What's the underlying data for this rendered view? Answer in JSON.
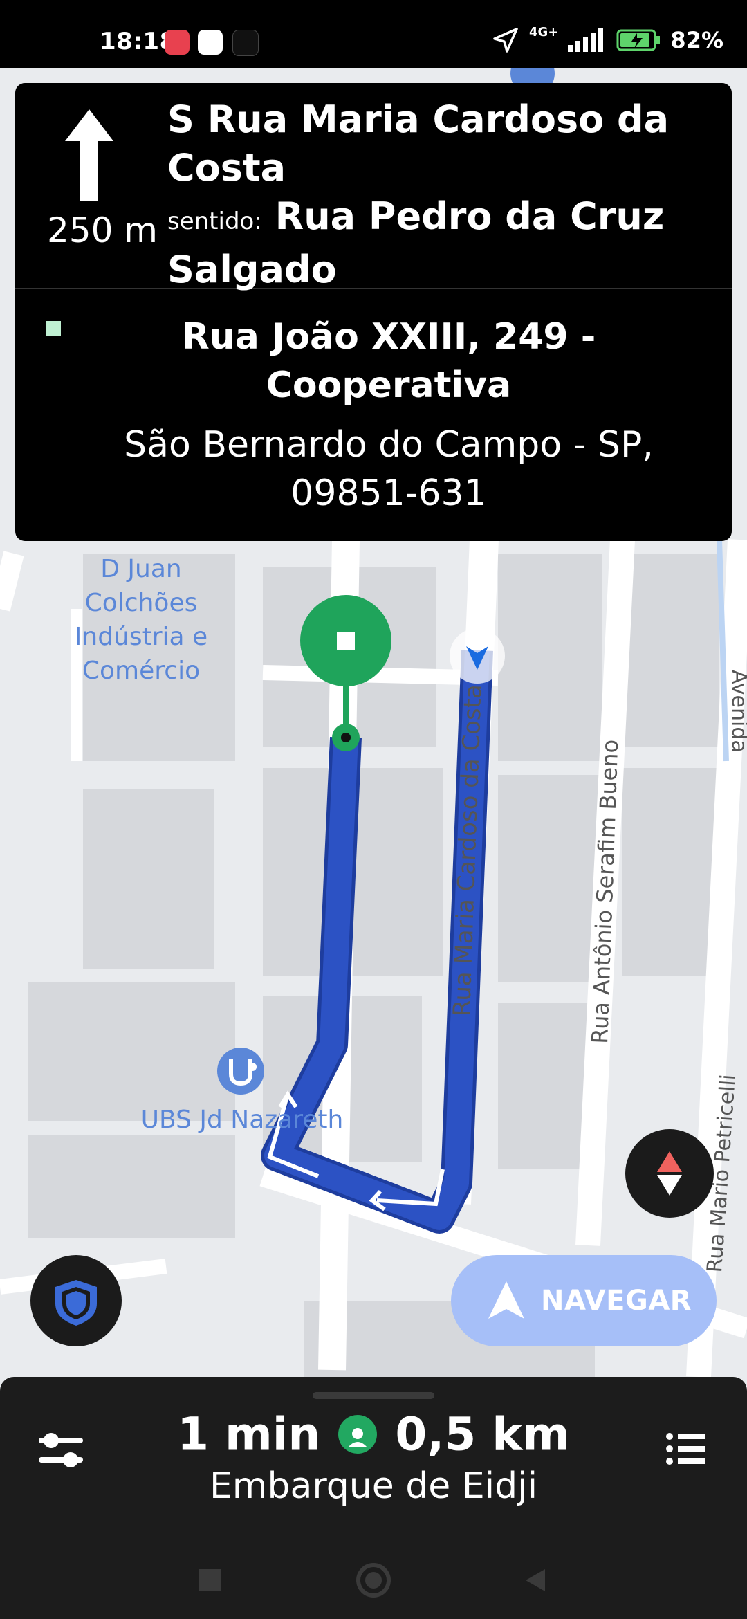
{
  "status_bar": {
    "time": "18:18",
    "network": "4G+",
    "battery": "82%"
  },
  "map": {
    "poi_juan": "D Juan Colchões Indústria e Comércio",
    "poi_ubs": "UBS Jd Nazareth",
    "streets": {
      "maria_cardoso": "Rua Maria Cardoso da Costa",
      "serafim": "Rua Antônio Serafim Bueno",
      "petricelli": "Rua Mario Petricelli",
      "avenida": "Avenida"
    }
  },
  "instruction": {
    "distance": "250 m",
    "street": "S Rua Maria Cardoso da Costa",
    "toward_prefix": "sentido:",
    "toward_street": "Rua Pedro da Cruz Salgado"
  },
  "destination": {
    "line1": "Rua João XXIII, 249 - Cooperativa",
    "line2": "São Bernardo do Campo - SP, 09851-631"
  },
  "nav_button": {
    "label": "NAVEGAR"
  },
  "trip": {
    "eta": "1 min",
    "distance": "0,5 km",
    "pickup": "Embarque de Eidji"
  },
  "colors": {
    "route": "#2c52c4",
    "pickup_pin": "#1fa45b",
    "nav_button": "#a6bff8",
    "poi_text": "#5b87d8"
  },
  "icons": [
    "turn-straight-arrow-icon",
    "shield-icon",
    "compass-icon",
    "navigate-arrow-icon",
    "sliders-icon",
    "list-icon",
    "rider-icon",
    "square-nav-icon",
    "home-nav-icon",
    "back-nav-icon"
  ]
}
